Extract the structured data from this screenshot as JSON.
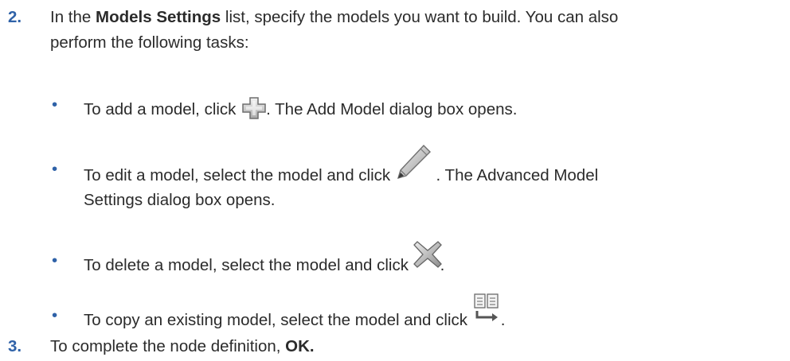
{
  "step2": {
    "number": "2.",
    "before": "In the ",
    "bold": "Models Settings",
    "after_line1": " list, specify the models you want to build. You can also",
    "line2": "perform the following tasks:"
  },
  "bullets": [
    {
      "marker": "•",
      "before": "To add a model, click ",
      "icon": "add-icon",
      "after": ". The Add Model dialog box opens."
    },
    {
      "marker": "•",
      "before": "To edit a model, select the model and click ",
      "icon": "pencil-icon",
      "after": " . The Advanced Model",
      "line2": "Settings dialog box opens."
    },
    {
      "marker": "•",
      "before": "To delete a model, select the model and click ",
      "icon": "delete-x-icon",
      "after": "."
    },
    {
      "marker": "•",
      "before": "To copy an existing model, select the model and click ",
      "icon": "copy-model-icon",
      "after": "."
    }
  ],
  "step3": {
    "number": "3.",
    "text": "To complete the node definition, ",
    "bold": "OK."
  },
  "colors": {
    "number": "#2f62a8",
    "text": "#2b2b2b"
  }
}
